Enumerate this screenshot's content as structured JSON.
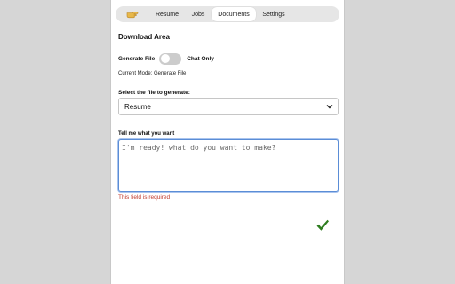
{
  "tabs": {
    "icon": "hand-pointing-icon",
    "items": [
      {
        "label": "Resume"
      },
      {
        "label": "Jobs"
      },
      {
        "label": "Documents"
      },
      {
        "label": "Settings"
      }
    ],
    "active": "Documents"
  },
  "main": {
    "title": "Download Area",
    "toggle": {
      "left_label": "Generate File",
      "right_label": "Chat Only",
      "state": "off"
    },
    "mode_text": "Current Mode: Generate File",
    "file_select": {
      "label": "Select the file to generate:",
      "value": "Resume"
    },
    "prompt": {
      "label": "Tell me what you want",
      "placeholder": "I'm ready! what do you want to make?",
      "value": ""
    },
    "error": "This field is required",
    "submit_icon": "checkmark-icon"
  },
  "colors": {
    "error": "#c0392b",
    "check": "#2e7d1f",
    "focus_border": "#5b8dd6",
    "hand_icon": "#e8b84a"
  }
}
